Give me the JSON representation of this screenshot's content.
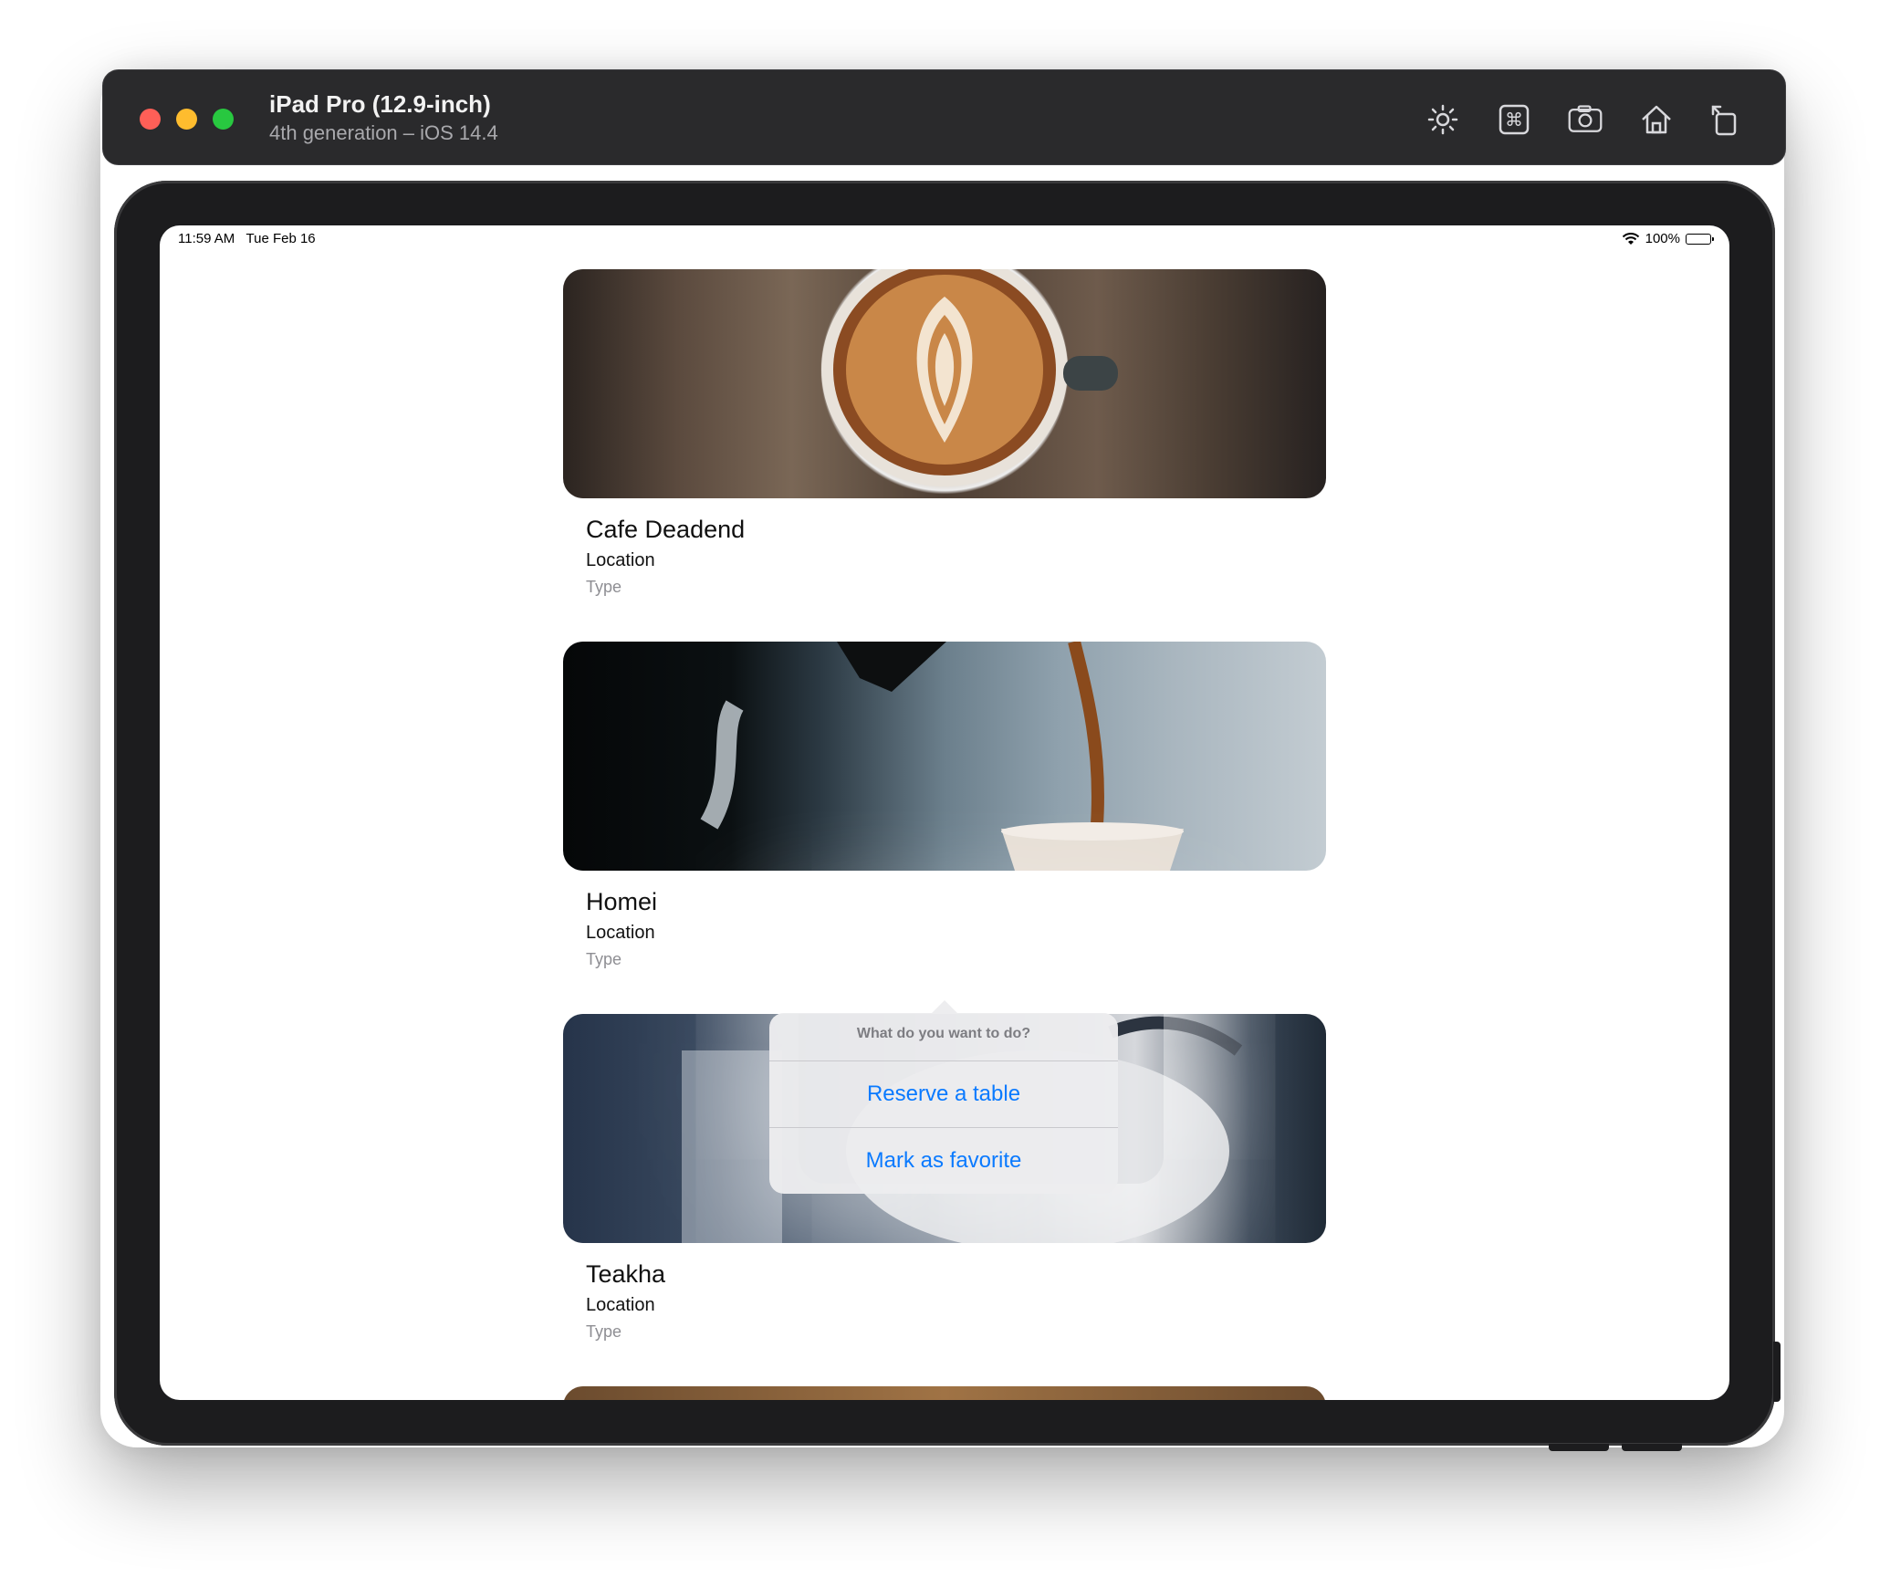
{
  "window": {
    "title": "iPad Pro (12.9-inch)",
    "subtitle": "4th generation – iOS 14.4",
    "toolbar_icons": [
      "brightness-icon",
      "command-icon",
      "screenshot-icon",
      "home-icon",
      "rotate-icon"
    ]
  },
  "statusbar": {
    "time": "11:59 AM   Tue Feb 16",
    "battery": "100%"
  },
  "restaurants": [
    {
      "name": "Cafe Deadend",
      "location": "Location",
      "type": "Type"
    },
    {
      "name": "Homei",
      "location": "Location",
      "type": "Type"
    },
    {
      "name": "Teakha",
      "location": "Location",
      "type": "Type"
    }
  ],
  "action_sheet": {
    "title": "What do you want to do?",
    "actions": [
      "Reserve a table",
      "Mark as favorite"
    ],
    "action_color": "#0a7aff"
  },
  "colors": {
    "close": "#ff5f57",
    "minimize": "#febc2e",
    "maximize": "#28c840"
  }
}
